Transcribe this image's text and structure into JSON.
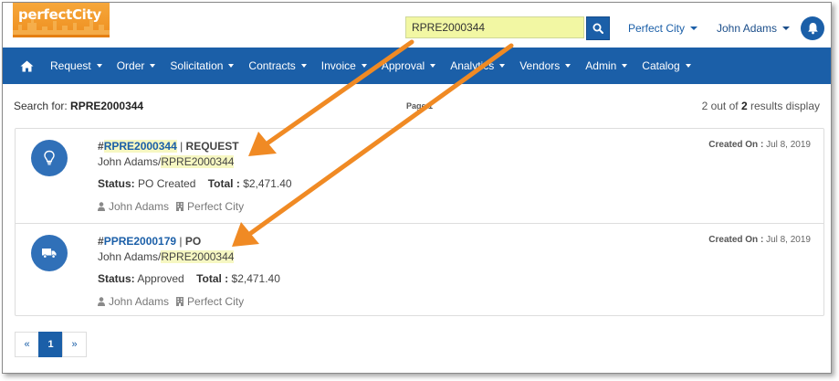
{
  "brand": {
    "logo_text": "perfectCity"
  },
  "search": {
    "value": "RPRE2000344"
  },
  "top_menu": {
    "org_label": "Perfect City",
    "user_label": "John Adams"
  },
  "nav": {
    "items": [
      {
        "label": "Request"
      },
      {
        "label": "Order"
      },
      {
        "label": "Solicitation"
      },
      {
        "label": "Contracts"
      },
      {
        "label": "Invoice"
      },
      {
        "label": "Approval"
      },
      {
        "label": "Analytics"
      },
      {
        "label": "Vendors"
      },
      {
        "label": "Admin"
      },
      {
        "label": "Catalog"
      }
    ]
  },
  "summary": {
    "search_for_label": "Search for:",
    "search_term": "RPRE2000344",
    "page_label": "Page 1",
    "count_prefix": "2 out of",
    "count_value": "2",
    "count_suffix": "results display"
  },
  "results": [
    {
      "icon": "lightbulb-icon",
      "hash": "#",
      "number": "RPRE2000344",
      "separator": " | ",
      "type": "REQUEST",
      "owner_prefix": "John Adams/",
      "owner_ref": "RPRE2000344",
      "status_label": "Status:",
      "status_value": "PO Created",
      "total_label": "Total :",
      "total_value": "$2,471.40",
      "user": "John Adams",
      "org": "Perfect City",
      "created_label": "Created On :",
      "created_value": "Jul 8, 2019"
    },
    {
      "icon": "truck-icon",
      "hash": "#",
      "number": "PPRE2000179",
      "separator": " | ",
      "type": "PO",
      "owner_prefix": "John Adams/",
      "owner_ref": "RPRE2000344",
      "status_label": "Status:",
      "status_value": "Approved",
      "total_label": "Total :",
      "total_value": "$2,471.40",
      "user": "John Adams",
      "org": "Perfect City",
      "created_label": "Created On :",
      "created_value": "Jul 8, 2019"
    }
  ],
  "pagination": {
    "prev": "«",
    "current": "1",
    "next": "»"
  },
  "colors": {
    "primary": "#1b5fa8",
    "highlight": "#f2f7a3",
    "arrow": "#f08a24",
    "logo": "#f09a2a"
  }
}
